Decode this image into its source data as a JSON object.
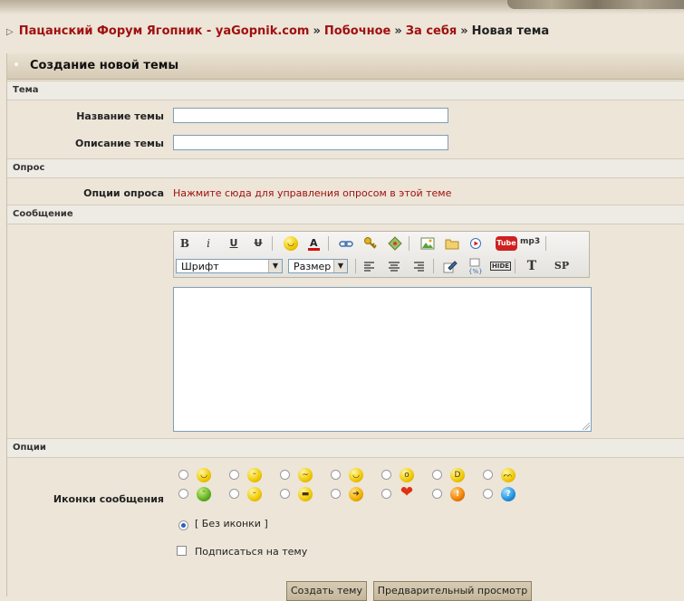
{
  "breadcrumb": {
    "items": [
      "Пацанский Форум Ягопник - yaGopnik.com",
      "Побочное",
      "За себя"
    ],
    "current": "Новая тема",
    "separator": "»"
  },
  "form": {
    "title": "Создание новой темы",
    "sections": {
      "topic": "Тема",
      "poll": "Опрос",
      "message": "Сообщение",
      "options": "Опции"
    },
    "fields": {
      "topic_title_label": "Название темы",
      "topic_title_value": "",
      "topic_desc_label": "Описание темы",
      "topic_desc_value": ""
    },
    "poll": {
      "label": "Опции опроса",
      "link": "Нажмите сюда для управления опросом в этой теме"
    },
    "editor": {
      "font_select": "Шрифт",
      "size_select": "Размер",
      "bold_glyph": "B",
      "italic_glyph": "i",
      "underline_glyph": "U",
      "strike_glyph": "U",
      "youtube_label": "Tube",
      "mp3_label": "mp3",
      "hide_label": "HIDE",
      "text_glyph": "T",
      "sp_label": "SP",
      "message_value": ""
    },
    "options": {
      "icons_label": "Иконки сообщения",
      "no_icon_label": "[ Без иконки ]",
      "subscribe_label": "Подписаться на тему",
      "icons": [
        "smile-icon",
        "rolleyes-icon",
        "sleepy-icon",
        "wink-icon",
        "surprised-icon",
        "laugh-icon",
        "angry-icon",
        "sick-icon",
        "blush-icon",
        "cool-icon",
        "arrow-icon",
        "heart-icon",
        "exclamation-icon",
        "question-icon"
      ]
    },
    "buttons": {
      "create": "Создать тему",
      "preview": "Предварительный просмотр"
    }
  },
  "colors": {
    "link": "#a01010",
    "background": "#ece5d8",
    "section_bg": "#eeebe4"
  }
}
